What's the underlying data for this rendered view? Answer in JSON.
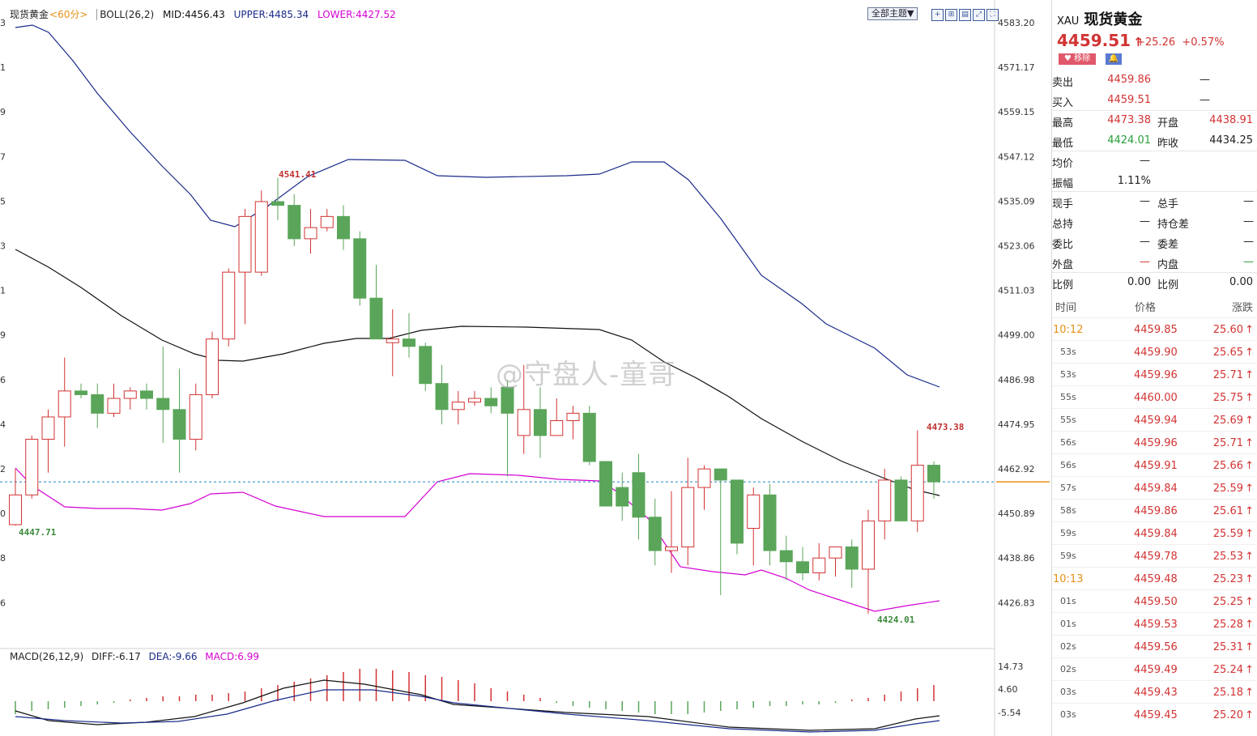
{
  "header": {
    "symbol_name": "现货黄金",
    "period": "<60分>",
    "boll_label": "BOLL(26,2)",
    "mid": "MID:4456.43",
    "upper": "UPPER:4485.34",
    "lower": "LOWER:4427.52",
    "theme_button": "全部主题▼"
  },
  "macd_header": {
    "label": "MACD(26,12,9)",
    "diff": "DIFF:-6.17",
    "dea": "DEA:-9.66",
    "macd": "MACD:6.99"
  },
  "price_axis": [
    "4583.20",
    "4571.17",
    "4559.15",
    "4547.12",
    "4535.09",
    "4523.06",
    "4511.03",
    "4499.00",
    "4486.98",
    "4474.95",
    "4462.92",
    "4450.89",
    "4438.86",
    "4426.83"
  ],
  "macd_axis": [
    "14.73",
    "4.60",
    "-5.54"
  ],
  "annotations": {
    "high_marker": "4541.41",
    "low_marker_left": "4447.71",
    "high_marker_right": "4473.38",
    "low_marker_right": "4424.01"
  },
  "watermark": "@守盘人-童哥",
  "chart_data": {
    "type": "candlestick",
    "ylim": [
      4426.83,
      4583.2
    ],
    "candles": [
      {
        "o": 4448,
        "h": 4463,
        "l": 4447.71,
        "c": 4456
      },
      {
        "o": 4456,
        "h": 4472,
        "l": 4455,
        "c": 4471
      },
      {
        "o": 4471,
        "h": 4479,
        "l": 4462,
        "c": 4477
      },
      {
        "o": 4477,
        "h": 4493,
        "l": 4469,
        "c": 4484
      },
      {
        "o": 4484,
        "h": 4486,
        "l": 4482,
        "c": 4483
      },
      {
        "o": 4483,
        "h": 4486,
        "l": 4474,
        "c": 4478
      },
      {
        "o": 4478,
        "h": 4486,
        "l": 4477,
        "c": 4482
      },
      {
        "o": 4482,
        "h": 4485,
        "l": 4479,
        "c": 4484
      },
      {
        "o": 4484,
        "h": 4486,
        "l": 4479,
        "c": 4482
      },
      {
        "o": 4482,
        "h": 4496,
        "l": 4470,
        "c": 4479
      },
      {
        "o": 4479,
        "h": 4490,
        "l": 4462,
        "c": 4471
      },
      {
        "o": 4471,
        "h": 4486,
        "l": 4468,
        "c": 4483
      },
      {
        "o": 4483,
        "h": 4500,
        "l": 4482,
        "c": 4498
      },
      {
        "o": 4498,
        "h": 4517,
        "l": 4496,
        "c": 4516
      },
      {
        "o": 4516,
        "h": 4533,
        "l": 4502,
        "c": 4531
      },
      {
        "o": 4516,
        "h": 4538,
        "l": 4515,
        "c": 4535
      },
      {
        "o": 4535,
        "h": 4541.41,
        "l": 4530,
        "c": 4534
      },
      {
        "o": 4534,
        "h": 4537,
        "l": 4523,
        "c": 4525
      },
      {
        "o": 4525,
        "h": 4533,
        "l": 4521,
        "c": 4528
      },
      {
        "o": 4528,
        "h": 4533,
        "l": 4527,
        "c": 4531
      },
      {
        "o": 4531,
        "h": 4534,
        "l": 4522,
        "c": 4525
      },
      {
        "o": 4525,
        "h": 4527,
        "l": 4507,
        "c": 4509
      },
      {
        "o": 4509,
        "h": 4518,
        "l": 4501,
        "c": 4498
      },
      {
        "o": 4497,
        "h": 4506,
        "l": 4488,
        "c": 4498
      },
      {
        "o": 4498,
        "h": 4505,
        "l": 4493,
        "c": 4496
      },
      {
        "o": 4496,
        "h": 4497,
        "l": 4484,
        "c": 4486
      },
      {
        "o": 4486,
        "h": 4491,
        "l": 4475,
        "c": 4479
      },
      {
        "o": 4479,
        "h": 4484,
        "l": 4475,
        "c": 4481
      },
      {
        "o": 4481,
        "h": 4484,
        "l": 4480,
        "c": 4482
      },
      {
        "o": 4482,
        "h": 4485,
        "l": 4478,
        "c": 4480
      },
      {
        "o": 4485,
        "h": 4487,
        "l": 4461,
        "c": 4478
      },
      {
        "o": 4472,
        "h": 4491,
        "l": 4467,
        "c": 4479
      },
      {
        "o": 4479,
        "h": 4485,
        "l": 4466,
        "c": 4472
      },
      {
        "o": 4472,
        "h": 4482,
        "l": 4472,
        "c": 4476
      },
      {
        "o": 4476,
        "h": 4480,
        "l": 4471,
        "c": 4478
      },
      {
        "o": 4478,
        "h": 4480,
        "l": 4464,
        "c": 4465
      },
      {
        "o": 4465,
        "h": 4465,
        "l": 4454,
        "c": 4453
      },
      {
        "o": 4458,
        "h": 4462,
        "l": 4449,
        "c": 4453
      },
      {
        "o": 4462,
        "h": 4467,
        "l": 4444,
        "c": 4450
      },
      {
        "o": 4450,
        "h": 4455,
        "l": 4437,
        "c": 4441
      },
      {
        "o": 4441,
        "h": 4457,
        "l": 4435,
        "c": 4442
      },
      {
        "o": 4442,
        "h": 4466,
        "l": 4437,
        "c": 4458
      },
      {
        "o": 4458,
        "h": 4464,
        "l": 4452,
        "c": 4463
      },
      {
        "o": 4463,
        "h": 4463,
        "l": 4429,
        "c": 4460
      },
      {
        "o": 4460,
        "h": 4458,
        "l": 4440,
        "c": 4443
      },
      {
        "o": 4447,
        "h": 4458,
        "l": 4437,
        "c": 4456
      },
      {
        "o": 4456,
        "h": 4459,
        "l": 4437,
        "c": 4441
      },
      {
        "o": 4441,
        "h": 4445,
        "l": 4433,
        "c": 4438
      },
      {
        "o": 4438,
        "h": 4442,
        "l": 4433,
        "c": 4435
      },
      {
        "o": 4435,
        "h": 4443,
        "l": 4433,
        "c": 4439
      },
      {
        "o": 4439,
        "h": 4442,
        "l": 4434,
        "c": 4442
      },
      {
        "o": 4442,
        "h": 4444,
        "l": 4431,
        "c": 4436
      },
      {
        "o": 4436,
        "h": 4452,
        "l": 4424.01,
        "c": 4449
      },
      {
        "o": 4449,
        "h": 4463,
        "l": 4444,
        "c": 4460
      },
      {
        "o": 4460,
        "h": 4461,
        "l": 4449,
        "c": 4449
      },
      {
        "o": 4449,
        "h": 4473.38,
        "l": 4446,
        "c": 4464
      },
      {
        "o": 4464,
        "h": 4465,
        "l": 4455,
        "c": 4459.51
      }
    ],
    "current_price": 4459.51
  },
  "right_panel": {
    "code": "XAU",
    "name": "现货黄金",
    "price": "4459.51",
    "arrow": "↑",
    "change": "+25.26",
    "change_pct": "+0.57%",
    "remove_btn": "移除",
    "quote_rows": [
      {
        "l1": "卖出",
        "v1": "4459.86",
        "c1": "red",
        "l2": "",
        "v2": "—",
        "c2": ""
      },
      {
        "l1": "买入",
        "v1": "4459.51",
        "c1": "red",
        "l2": "",
        "v2": "—",
        "c2": ""
      },
      {
        "l1": "最高",
        "v1": "4473.38",
        "c1": "red",
        "l2": "开盘",
        "v2": "4438.91",
        "c2": "red"
      },
      {
        "l1": "最低",
        "v1": "4424.01",
        "c1": "green",
        "l2": "昨收",
        "v2": "4434.25",
        "c2": ""
      },
      {
        "l1": "均价",
        "v1": "—",
        "c1": "",
        "l2": "",
        "v2": "",
        "c2": ""
      },
      {
        "l1": "振幅",
        "v1": "1.11%",
        "c1": "",
        "l2": "",
        "v2": "",
        "c2": ""
      },
      {
        "l1": "现手",
        "v1": "—",
        "c1": "",
        "l2": "总手",
        "v2": "—",
        "c2": ""
      },
      {
        "l1": "总持",
        "v1": "—",
        "c1": "",
        "l2": "持仓差",
        "v2": "—",
        "c2": ""
      },
      {
        "l1": "委比",
        "v1": "—",
        "c1": "",
        "l2": "委差",
        "v2": "—",
        "c2": ""
      },
      {
        "l1": "外盘",
        "v1": "—",
        "c1": "red",
        "l2": "内盘",
        "v2": "—",
        "c2": "green"
      },
      {
        "l1": "比例",
        "v1": "0.00",
        "c1": "",
        "l2": "比例",
        "v2": "0.00",
        "c2": ""
      }
    ],
    "tick_headers": [
      "时间",
      "价格",
      "涨跌"
    ],
    "ticks": [
      {
        "t": "10:12",
        "major": true,
        "p": "4459.85",
        "d": "25.60"
      },
      {
        "t": "53s",
        "major": false,
        "p": "4459.90",
        "d": "25.65"
      },
      {
        "t": "53s",
        "major": false,
        "p": "4459.96",
        "d": "25.71"
      },
      {
        "t": "55s",
        "major": false,
        "p": "4460.00",
        "d": "25.75"
      },
      {
        "t": "55s",
        "major": false,
        "p": "4459.94",
        "d": "25.69"
      },
      {
        "t": "56s",
        "major": false,
        "p": "4459.96",
        "d": "25.71"
      },
      {
        "t": "56s",
        "major": false,
        "p": "4459.91",
        "d": "25.66"
      },
      {
        "t": "57s",
        "major": false,
        "p": "4459.84",
        "d": "25.59"
      },
      {
        "t": "58s",
        "major": false,
        "p": "4459.86",
        "d": "25.61"
      },
      {
        "t": "59s",
        "major": false,
        "p": "4459.84",
        "d": "25.59"
      },
      {
        "t": "59s",
        "major": false,
        "p": "4459.78",
        "d": "25.53"
      },
      {
        "t": "10:13",
        "major": true,
        "p": "4459.48",
        "d": "25.23"
      },
      {
        "t": "01s",
        "major": false,
        "p": "4459.50",
        "d": "25.25"
      },
      {
        "t": "01s",
        "major": false,
        "p": "4459.53",
        "d": "25.28"
      },
      {
        "t": "02s",
        "major": false,
        "p": "4459.56",
        "d": "25.31"
      },
      {
        "t": "02s",
        "major": false,
        "p": "4459.49",
        "d": "25.24"
      },
      {
        "t": "03s",
        "major": false,
        "p": "4459.43",
        "d": "25.18"
      },
      {
        "t": "03s",
        "major": false,
        "p": "4459.45",
        "d": "25.20"
      }
    ]
  }
}
